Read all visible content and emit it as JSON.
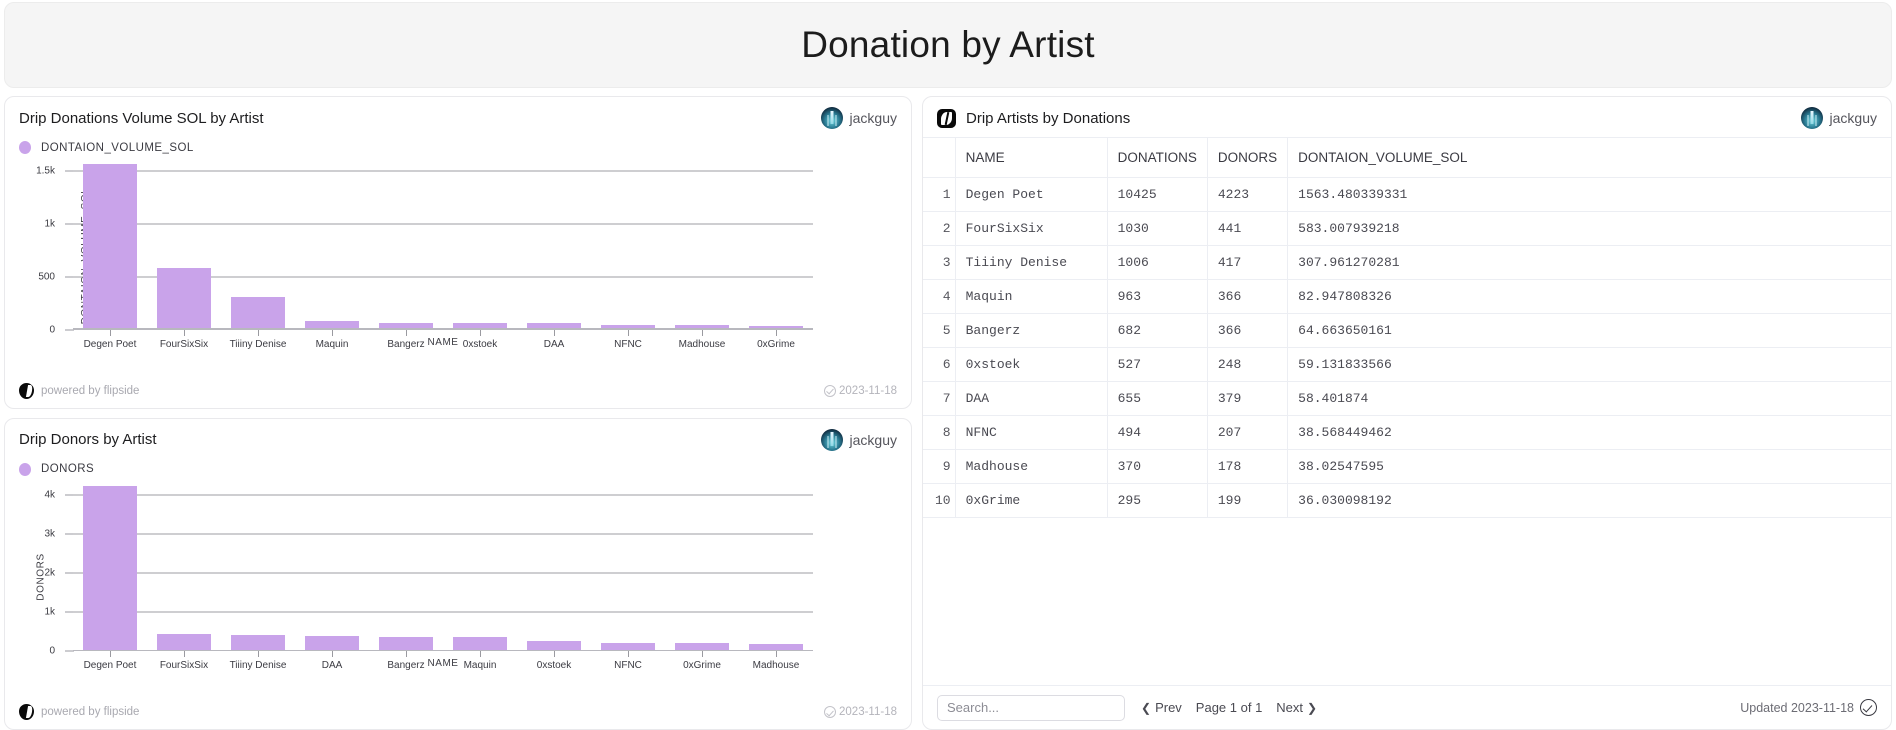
{
  "banner": {
    "title": "Donation by Artist"
  },
  "owner": {
    "name": "jackguy"
  },
  "charts": [
    {
      "title": "Drip Donations Volume SOL by Artist",
      "legend": "DONTAION_VOLUME_SOL",
      "footer_text": "powered by flipside",
      "date": "2023-11-18"
    },
    {
      "title": "Drip Donors by Artist",
      "legend": "DONORS",
      "footer_text": "powered by flipside",
      "date": "2023-11-18"
    }
  ],
  "table": {
    "title": "Drip Artists by Donations",
    "columns": [
      "",
      "NAME",
      "DONATIONS",
      "DONORS",
      "DONTAION_VOLUME_SOL"
    ],
    "rows": [
      [
        "1",
        "Degen Poet",
        "10425",
        "4223",
        "1563.480339331"
      ],
      [
        "2",
        "FourSixSix",
        "1030",
        "441",
        "583.007939218"
      ],
      [
        "3",
        "Tiiiny Denise",
        "1006",
        "417",
        "307.961270281"
      ],
      [
        "4",
        "Maquin",
        "963",
        "366",
        "82.947808326"
      ],
      [
        "5",
        "Bangerz",
        "682",
        "366",
        "64.663650161"
      ],
      [
        "6",
        "0xstoek",
        "527",
        "248",
        "59.131833566"
      ],
      [
        "7",
        "DAA",
        "655",
        "379",
        "58.401874"
      ],
      [
        "8",
        "NFNC",
        "494",
        "207",
        "38.568449462"
      ],
      [
        "9",
        "Madhouse",
        "370",
        "178",
        "38.02547595"
      ],
      [
        "10",
        "0xGrime",
        "295",
        "199",
        "36.030098192"
      ]
    ],
    "search_placeholder": "Search...",
    "prev_label": "Prev",
    "page_label": "Page 1 of 1",
    "next_label": "Next",
    "updated_label": "Updated 2023-11-18"
  },
  "colors": {
    "bar": "#c9a3ea",
    "banner_bg": "#f5f5f5",
    "grid": "#9d9da3"
  },
  "chart_data": [
    {
      "type": "bar",
      "title": "Drip Donations Volume SOL by Artist",
      "xlabel": "NAME",
      "ylabel": "DONTAION_VOLUME_SOL",
      "series_name": "DONTAION_VOLUME_SOL",
      "categories": [
        "Degen Poet",
        "FourSixSix",
        "Tiiiny Denise",
        "Maquin",
        "Bangerz",
        "0xstoek",
        "DAA",
        "NFNC",
        "Madhouse",
        "0xGrime"
      ],
      "values": [
        1563.480339331,
        583.007939218,
        307.961270281,
        82.947808326,
        64.663650161,
        59.131833566,
        58.401874,
        38.568449462,
        38.02547595,
        36.030098192
      ],
      "yticks": [
        0,
        500,
        1000,
        1500
      ],
      "ytick_labels": [
        "0",
        "500",
        "1k",
        "1.5k"
      ],
      "ylim": [
        0,
        1600
      ],
      "grid": true,
      "legend_position": "top-left"
    },
    {
      "type": "bar",
      "title": "Drip Donors by Artist",
      "xlabel": "NAME",
      "ylabel": "DONORS",
      "series_name": "DONORS",
      "categories": [
        "Degen Poet",
        "FourSixSix",
        "Tiiiny Denise",
        "DAA",
        "Bangerz",
        "Maquin",
        "0xstoek",
        "NFNC",
        "0xGrime",
        "Madhouse"
      ],
      "values": [
        4223,
        441,
        417,
        379,
        366,
        366,
        248,
        207,
        199,
        178
      ],
      "yticks": [
        0,
        1000,
        2000,
        3000,
        4000
      ],
      "ytick_labels": [
        "0",
        "1k",
        "2k",
        "3k",
        "4k"
      ],
      "ylim": [
        0,
        4350
      ],
      "grid": true,
      "legend_position": "top-left"
    }
  ]
}
